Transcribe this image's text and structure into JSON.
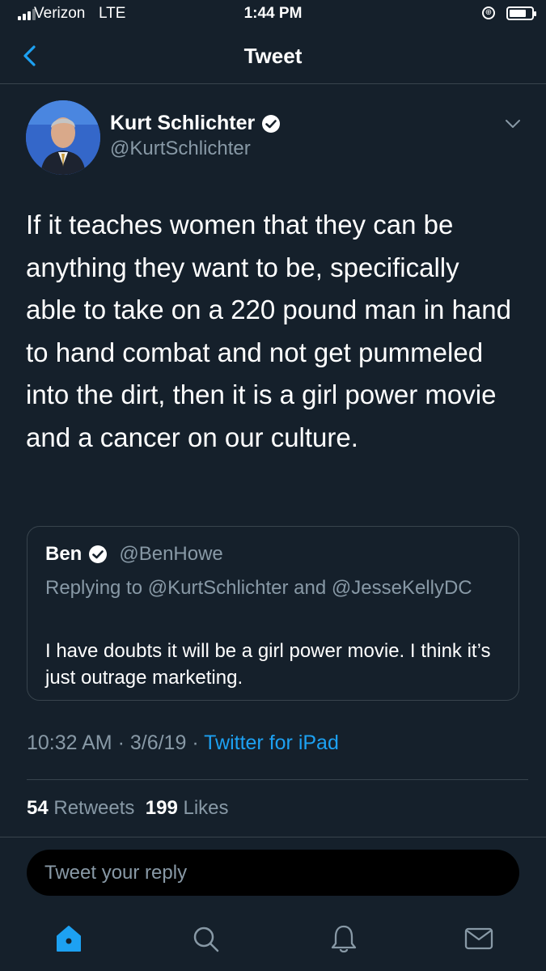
{
  "status_bar": {
    "carrier": "Verizon",
    "network": "LTE",
    "time": "1:44 PM",
    "battery_level": 0.75
  },
  "nav": {
    "title": "Tweet",
    "back_icon": "chevron-left-icon"
  },
  "tweet": {
    "author_name": "Kurt Schlichter",
    "author_handle": "@KurtSchlichter",
    "text": "If it teaches women that they can be anything they want to be, specifically able to take on a 220 pound man in hand to hand combat and not get pummeled into the dirt, then it is a girl power movie and a cancer on our culture.",
    "time": "10:32 AM",
    "date": "3/6/19",
    "source": "Twitter for iPad",
    "retweets_count": "54",
    "retweets_label": "Retweets",
    "likes_count": "199",
    "likes_label": "Likes"
  },
  "quoted_tweet": {
    "author_name": "Ben",
    "author_handle": "@BenHowe",
    "replying_to": "Replying to @KurtSchlichter and @JesseKellyDC",
    "text": "I have doubts it will be a girl power movie. I think it’s just outrage marketing."
  },
  "reply": {
    "placeholder": "Tweet your reply"
  },
  "tab_bar": {
    "items": [
      "home-icon",
      "search-icon",
      "notifications-icon",
      "messages-icon"
    ],
    "active": "home-icon"
  },
  "colors": {
    "background": "#15202b",
    "accent": "#1da1f2",
    "secondary_text": "#8899a6",
    "divider": "#38444d"
  }
}
